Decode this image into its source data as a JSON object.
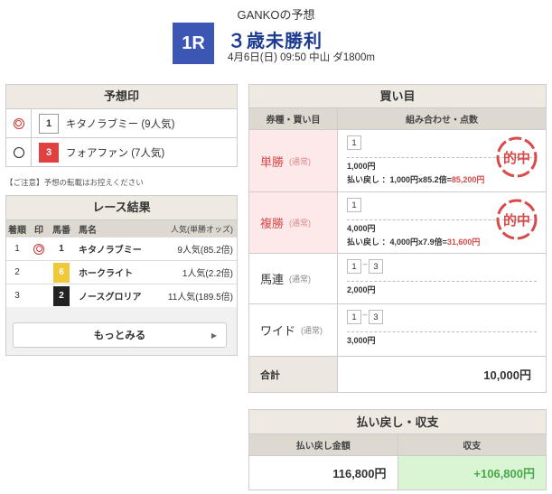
{
  "header": {
    "title": "GANKOの予想",
    "race_no": "1R",
    "race_name": "３歳未勝利",
    "race_info": "4月6日(日) 09:50 中山 ダ1800m"
  },
  "prediction": {
    "title": "予想印",
    "items": [
      {
        "mark": "double-circle",
        "num": "1",
        "name": "キタノラブミー (9人気)",
        "num_bg": "#ffffff",
        "num_color": "#333333"
      },
      {
        "mark": "circle",
        "num": "3",
        "name": "フォアファン (7人気)",
        "num_bg": "#e04040",
        "num_color": "#ffffff"
      }
    ],
    "notice": "【ご注意】予想の転載はお控えください"
  },
  "result": {
    "title": "レース結果",
    "columns": {
      "pos": "着順",
      "mark": "印",
      "num": "馬番",
      "name": "馬名",
      "pop": "人気(単勝オッズ)"
    },
    "rows": [
      {
        "pos": "1",
        "mark": "double-circle",
        "num": "1",
        "name": "キタノラブミー",
        "pop": "9人気(85.2倍)",
        "num_bg": "#ffffff",
        "num_color": "#333333"
      },
      {
        "pos": "2",
        "mark": "",
        "num": "6",
        "name": "ホークライト",
        "pop": "1人気(2.2倍)",
        "num_bg": "#f0c93a",
        "num_color": "#ffffff"
      },
      {
        "pos": "3",
        "mark": "",
        "num": "2",
        "name": "ノースグロリア",
        "pop": "11人気(189.5倍)",
        "num_bg": "#222222",
        "num_color": "#ffffff"
      }
    ],
    "more_label": "もっとみる"
  },
  "bets": {
    "title": "買い目",
    "col_type": "券種・買い目",
    "col_combo": "組み合わせ・点数",
    "stamp_text": "的中",
    "rows": [
      {
        "type": "単勝",
        "suffix": "(通常)",
        "hit": true,
        "combo": [
          "1"
        ],
        "amount": "1,000円",
        "payout_label": "払い戻し",
        "payout_calc": "：1,000円x85.2倍=",
        "payout_result": "85,200円"
      },
      {
        "type": "複勝",
        "suffix": "(通常)",
        "hit": true,
        "combo": [
          "1"
        ],
        "amount": "4,000円",
        "payout_label": "払い戻し",
        "payout_calc": "：4,000円x7.9倍=",
        "payout_result": "31,600円"
      },
      {
        "type": "馬連",
        "suffix": "(通常)",
        "hit": false,
        "combo": [
          "1",
          "3"
        ],
        "amount": "2,000円"
      },
      {
        "type": "ワイド",
        "suffix": "(通常)",
        "hit": false,
        "combo": [
          "1",
          "3"
        ],
        "amount": "3,000円"
      }
    ],
    "total_label": "合計",
    "total_value": "10,000円"
  },
  "payout": {
    "title": "払い戻し・収支",
    "col_payout": "払い戻し金額",
    "col_balance": "収支",
    "payout_value": "116,800円",
    "balance_value": "+106,800円"
  },
  "colors": {
    "accent": "#3c57b3",
    "hit": "#d94a4a",
    "plus": "#49a94a"
  }
}
